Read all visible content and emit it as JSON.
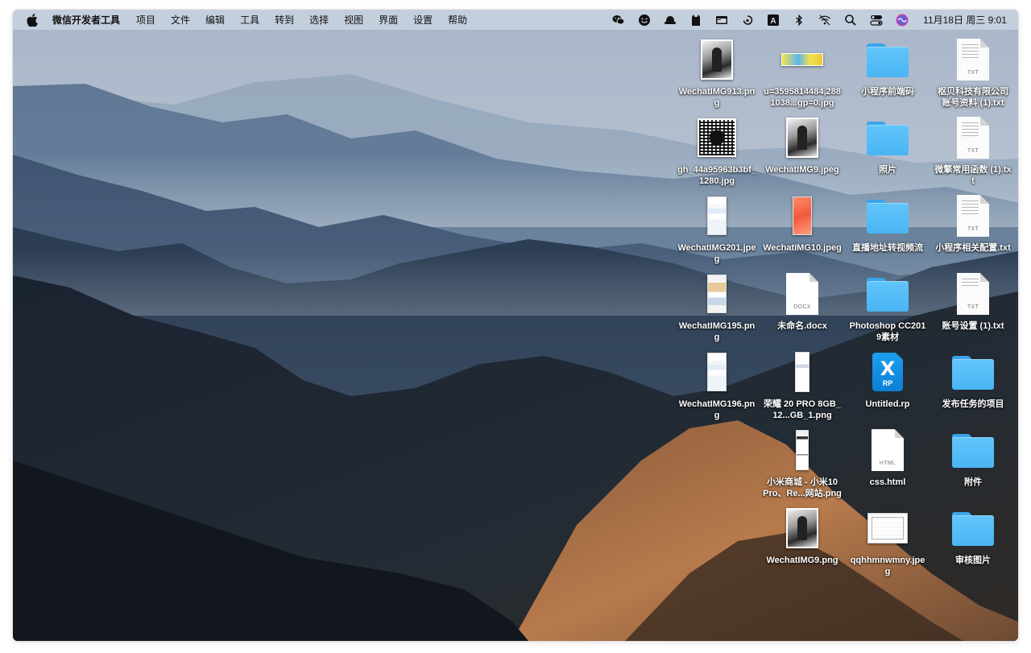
{
  "menubar": {
    "app_name": "微信开发者工具",
    "menus": [
      "项目",
      "文件",
      "编辑",
      "工具",
      "转到",
      "选择",
      "视图",
      "界面",
      "设置",
      "帮助"
    ],
    "status_icons": [
      "wechat-icon",
      "smiley-icon",
      "hat-icon",
      "cat-icon",
      "window-icon",
      "swirl-icon",
      "text-input-icon",
      "bluetooth-icon",
      "wifi-icon",
      "search-icon",
      "control-center-icon",
      "siri-icon"
    ],
    "input_source": "A",
    "clock": "11月18日 周三  9:01"
  },
  "desktop": {
    "items": [
      {
        "label": "WechatIMG913.png",
        "kind": "photo-bw"
      },
      {
        "label": "u=3595814484,2881038...gp=0.jpg",
        "kind": "photo-banner"
      },
      {
        "label": "小程序前端码",
        "kind": "folder"
      },
      {
        "label": "枢贝科技有限公司账号资料 (1).txt",
        "kind": "txt"
      },
      {
        "label": "gh_44a95963b3bf_1280.jpg",
        "kind": "photo-qr"
      },
      {
        "label": "WechatIMG9.jpeg",
        "kind": "photo-bw"
      },
      {
        "label": "照片",
        "kind": "folder"
      },
      {
        "label": "微擎常用函数 (1).txt",
        "kind": "txt"
      },
      {
        "label": "WechatIMG201.jpeg",
        "kind": "photo-phone"
      },
      {
        "label": "WechatIMG10.jpeg",
        "kind": "photo-orange"
      },
      {
        "label": "直播地址转视频流",
        "kind": "folder"
      },
      {
        "label": "小程序相关配置.txt",
        "kind": "txt"
      },
      {
        "label": "WechatIMG195.png",
        "kind": "photo-strip"
      },
      {
        "label": "未命名.docx",
        "kind": "docx"
      },
      {
        "label": "Photoshop CC2019素材",
        "kind": "folder"
      },
      {
        "label": "账号设置 (1).txt",
        "kind": "txt"
      },
      {
        "label": "WechatIMG196.png",
        "kind": "photo-phone"
      },
      {
        "label": "荣耀 20 PRO 8GB_12...GB_1.png",
        "kind": "photo-tall"
      },
      {
        "label": "Untitled.rp",
        "kind": "rp"
      },
      {
        "label": "发布任务的项目",
        "kind": "folder"
      },
      {
        "label": "小米商城 - 小米10 Pro、Re...网站.png",
        "kind": "photo-dark"
      },
      {
        "label": "css.html",
        "kind": "html"
      },
      {
        "label": "附件",
        "kind": "folder"
      },
      {
        "label": "WechatIMG9.png",
        "kind": "photo-bw"
      },
      {
        "label": "qqhhmnwmny.jpeg",
        "kind": "photo-cert"
      },
      {
        "label": "审核图片",
        "kind": "folder"
      }
    ],
    "ext_labels": {
      "txt": "TXT",
      "docx": "DOCX",
      "html": "HTML",
      "rp": "RP",
      "rp_mark": "X"
    }
  },
  "colors": {
    "folder": "#4ab5f4",
    "menubar": "#ced8e6",
    "rp": "#0e7fd3"
  }
}
